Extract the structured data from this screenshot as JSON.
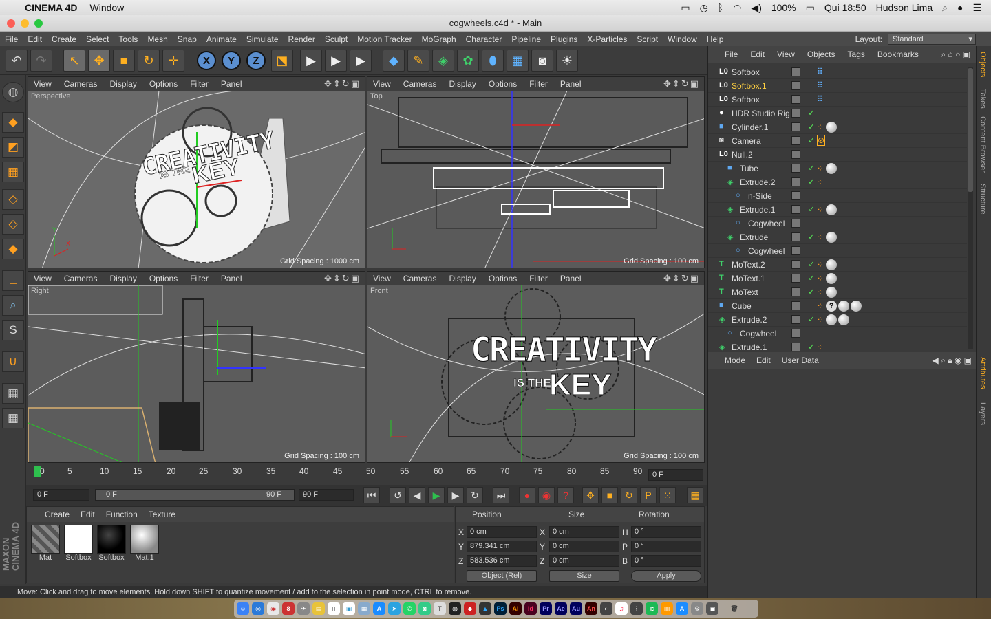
{
  "macbar": {
    "apple": "",
    "app": "CINEMA 4D",
    "menu": "Window",
    "battery": "100%",
    "datetime": "Qui 18:50",
    "user": "Hudson Lima"
  },
  "window": {
    "title": "cogwheels.c4d * - Main"
  },
  "menu": [
    "File",
    "Edit",
    "Create",
    "Select",
    "Tools",
    "Mesh",
    "Snap",
    "Animate",
    "Simulate",
    "Render",
    "Sculpt",
    "Motion Tracker",
    "MoGraph",
    "Character",
    "Pipeline",
    "Plugins",
    "X-Particles",
    "Script",
    "Window",
    "Help"
  ],
  "layout": {
    "label": "Layout:",
    "value": "Standard"
  },
  "viewport_menu": [
    "View",
    "Cameras",
    "Display",
    "Options",
    "Filter",
    "Panel"
  ],
  "viewports": [
    {
      "name": "Perspective",
      "grid": "Grid Spacing : 1000 cm"
    },
    {
      "name": "Top",
      "grid": "Grid Spacing : 100 cm"
    },
    {
      "name": "Right",
      "grid": "Grid Spacing : 100 cm"
    },
    {
      "name": "Front",
      "grid": "Grid Spacing : 100 cm"
    }
  ],
  "scene_text": {
    "line1": "CREATIVITY",
    "line2a": "IS THE",
    "line2b": "KEY"
  },
  "timeline": {
    "ticks": [
      "0",
      "5",
      "10",
      "15",
      "20",
      "25",
      "30",
      "35",
      "40",
      "45",
      "50",
      "55",
      "60",
      "65",
      "70",
      "75",
      "80",
      "85",
      "90"
    ],
    "current": "0 F",
    "start": "0 F",
    "range_start": "0 F",
    "range_end": "90 F",
    "end": "90 F"
  },
  "material_manager": {
    "menu": [
      "Create",
      "Edit",
      "Function",
      "Texture"
    ],
    "materials": [
      {
        "name": "Mat"
      },
      {
        "name": "Softbox"
      },
      {
        "name": "Softbox"
      },
      {
        "name": "Mat.1"
      }
    ]
  },
  "coords": {
    "headers": [
      "Position",
      "Size",
      "Rotation"
    ],
    "rows": [
      {
        "pl": "X",
        "pv": "0 cm",
        "sl": "X",
        "sv": "0 cm",
        "rl": "H",
        "rv": "0 °"
      },
      {
        "pl": "Y",
        "pv": "879.341 cm",
        "sl": "Y",
        "sv": "0 cm",
        "rl": "P",
        "rv": "0 °"
      },
      {
        "pl": "Z",
        "pv": "583.536 cm",
        "sl": "Z",
        "sv": "0 cm",
        "rl": "B",
        "rv": "0 °"
      }
    ],
    "mode": "Object (Rel)",
    "size_mode": "Size",
    "apply": "Apply"
  },
  "status": "Move: Click and drag to move elements. Hold down SHIFT to quantize movement / add to the selection in point mode, CTRL to remove.",
  "object_manager": {
    "menu": [
      "File",
      "Edit",
      "View",
      "Objects",
      "Tags",
      "Bookmarks"
    ],
    "objects": [
      {
        "name": "Softbox",
        "indent": 0,
        "type": "null"
      },
      {
        "name": "Softbox.1",
        "indent": 0,
        "type": "null",
        "selected": true
      },
      {
        "name": "Softbox",
        "indent": 0,
        "type": "null"
      },
      {
        "name": "HDR Studio Rig",
        "indent": 0,
        "type": "sphere"
      },
      {
        "name": "Cylinder.1",
        "indent": 0,
        "type": "prim"
      },
      {
        "name": "Camera",
        "indent": 0,
        "type": "camera"
      },
      {
        "name": "Null.2",
        "indent": 0,
        "type": "null"
      },
      {
        "name": "Tube",
        "indent": 1,
        "type": "prim"
      },
      {
        "name": "Extrude.2",
        "indent": 1,
        "type": "gen"
      },
      {
        "name": "n-Side",
        "indent": 2,
        "type": "spline"
      },
      {
        "name": "Extrude.1",
        "indent": 1,
        "type": "gen"
      },
      {
        "name": "Cogwheel",
        "indent": 2,
        "type": "spline"
      },
      {
        "name": "Extrude",
        "indent": 1,
        "type": "gen"
      },
      {
        "name": "Cogwheel",
        "indent": 2,
        "type": "spline"
      },
      {
        "name": "MoText.2",
        "indent": 0,
        "type": "text"
      },
      {
        "name": "MoText.1",
        "indent": 0,
        "type": "text"
      },
      {
        "name": "MoText",
        "indent": 0,
        "type": "text"
      },
      {
        "name": "Cube",
        "indent": 0,
        "type": "prim"
      },
      {
        "name": "Extrude.2",
        "indent": 0,
        "type": "gen"
      },
      {
        "name": "Cogwheel",
        "indent": 1,
        "type": "spline"
      },
      {
        "name": "Extrude.1",
        "indent": 0,
        "type": "gen"
      }
    ]
  },
  "attributes": {
    "menu": [
      "Mode",
      "Edit",
      "User Data"
    ]
  },
  "right_tabs": [
    "Objects",
    "Takes",
    "Content Browser",
    "Structure",
    "Attributes",
    "Layers"
  ],
  "side_logo": {
    "line1": "MAXON",
    "line2": "CINEMA 4D"
  },
  "colors": {
    "accent": "#ffb020",
    "selected_text": "#ffd040",
    "bg": "#3a3a3a",
    "viewport": "#5f5f5f"
  }
}
